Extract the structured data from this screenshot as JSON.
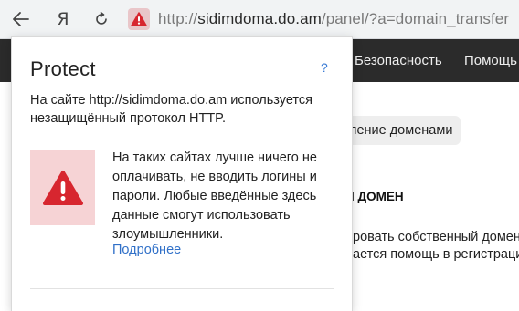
{
  "browser": {
    "back_icon": "arrow-left-icon",
    "yandex_label": "Я",
    "reload_icon": "reload-icon",
    "warning_icon": "warning-triangle-icon",
    "url_host": "sidimdoma.do.am",
    "url_prefix": "http://",
    "url_path": "/panel/?a=domain_transfer",
    "warning_color": "#d7262f"
  },
  "page": {
    "nav_items": [
      "Безопасность",
      "Помощь"
    ],
    "pill_label": "ление доменами",
    "heading": "Й ДОМЕН",
    "lines": [
      "ровать собственный домен",
      "ается помощь в регистрации"
    ]
  },
  "popup": {
    "title": "Protect",
    "help": "?",
    "message": "На сайте http://sidimdoma.do.am используется незащищённый протокол HTTP.",
    "advice": "На таких сайтах лучше ничего не оплачивать, не вводить логины и пароли. Любые введённые здесь данные смогут использовать злоумышленники.",
    "more_link": "Подробнее"
  }
}
